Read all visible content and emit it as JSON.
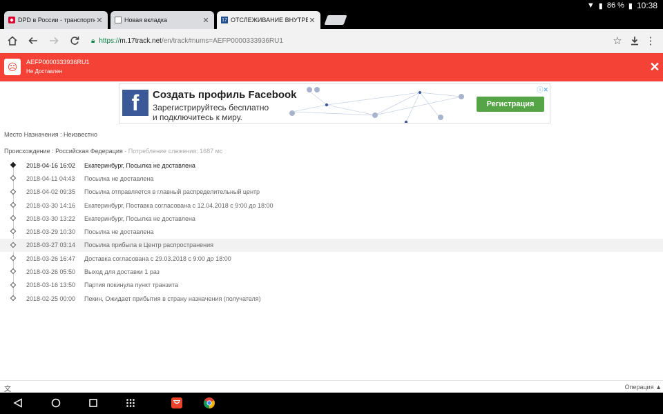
{
  "status_bar": {
    "battery": "86 %",
    "time": "10:38"
  },
  "tabs": [
    {
      "title": "DPD в России - транспортная ко",
      "active": false,
      "favicon": "dpd-icon"
    },
    {
      "title": "Новая вкладка",
      "active": false,
      "favicon": "page-icon"
    },
    {
      "title": "ОТСЛЕЖИВАНИЕ ВНУТРЕННЕГО",
      "active": true,
      "favicon": "17track-icon"
    }
  ],
  "address_bar": {
    "scheme": "https://",
    "host": "m.17track.net",
    "path": "/en/track#nums=AEFP0000333936RU1"
  },
  "banner": {
    "tracking_number": "AEFP0000333936RU1",
    "status": "Не Доставлен"
  },
  "ad": {
    "headline": "Создать профиль Facebook",
    "line1": "Зарегистрируйтесь бесплатно",
    "line2": "и подключитесь к миру.",
    "cta": "Регистрация"
  },
  "info": {
    "destination": "Место Назначения : Неизвестно",
    "origin": "Происхождение : Российская Федерация",
    "consumption": " - Потребление слежения: 1687 мс"
  },
  "events": [
    {
      "date": "2018-04-16 16:02",
      "desc": "Екатеринбург, Посылка не доставлена"
    },
    {
      "date": "2018-04-11 04:43",
      "desc": "Посылка не доставлена"
    },
    {
      "date": "2018-04-02 09:35",
      "desc": "Посылка отправляется в главный распределительный центр"
    },
    {
      "date": "2018-03-30 14:16",
      "desc": "Екатеринбург, Поставка согласована с 12.04.2018 с 9:00 до 18:00"
    },
    {
      "date": "2018-03-30 13:22",
      "desc": "Екатеринбург, Посылка не доставлена"
    },
    {
      "date": "2018-03-29 10:30",
      "desc": "Посылка не доставлена"
    },
    {
      "date": "2018-03-27 03:14",
      "desc": "Посылка прибыла в Центр распространения"
    },
    {
      "date": "2018-03-26 16:47",
      "desc": "Доставка согласована с 29.03.2018 с 9:00 до 18:00"
    },
    {
      "date": "2018-03-26 05:50",
      "desc": "Выход для доставки 1 раз"
    },
    {
      "date": "2018-03-16 13:50",
      "desc": "Партия покинула пункт транзита"
    },
    {
      "date": "2018-02-25 00:00",
      "desc": "Пекин, Ожидает прибытия в страну назначения (получателя)"
    }
  ],
  "footer": {
    "operations_label": "Операция ▲"
  },
  "colors": {
    "banner": "#f44336",
    "facebook": "#3b5998",
    "cta": "#55a546",
    "secure": "#0b8043"
  }
}
